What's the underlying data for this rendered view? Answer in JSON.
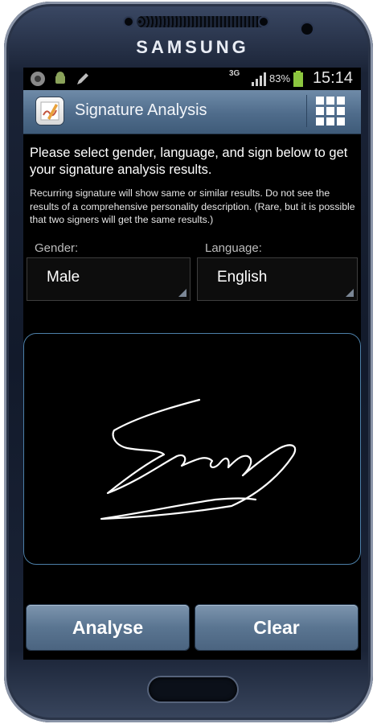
{
  "device": {
    "brand": "SAMSUNG"
  },
  "statusbar": {
    "network": "3G",
    "battery": "83%",
    "time": "15:14",
    "icons": [
      "chrome-icon",
      "android-debug-icon",
      "pencil-icon",
      "signal-icon",
      "battery-icon"
    ]
  },
  "app": {
    "title": "Signature Analysis",
    "menu_icon": "grid-icon"
  },
  "instructions": "Please select gender, language, and sign below to get your signature analysis results.",
  "note": "Recurring signature will show same or similar results. Do not see the results of a comprehensive personality description. (Rare, but it is possible that two signers will get the same results.)",
  "gender": {
    "label": "Gender:",
    "value": "Male"
  },
  "language": {
    "label": "Language:",
    "value": "English"
  },
  "signature_pad": {
    "stroke_color": "#ffffff",
    "border_color": "#4c7fa8"
  },
  "buttons": {
    "analyse": "Analyse",
    "clear": "Clear"
  }
}
